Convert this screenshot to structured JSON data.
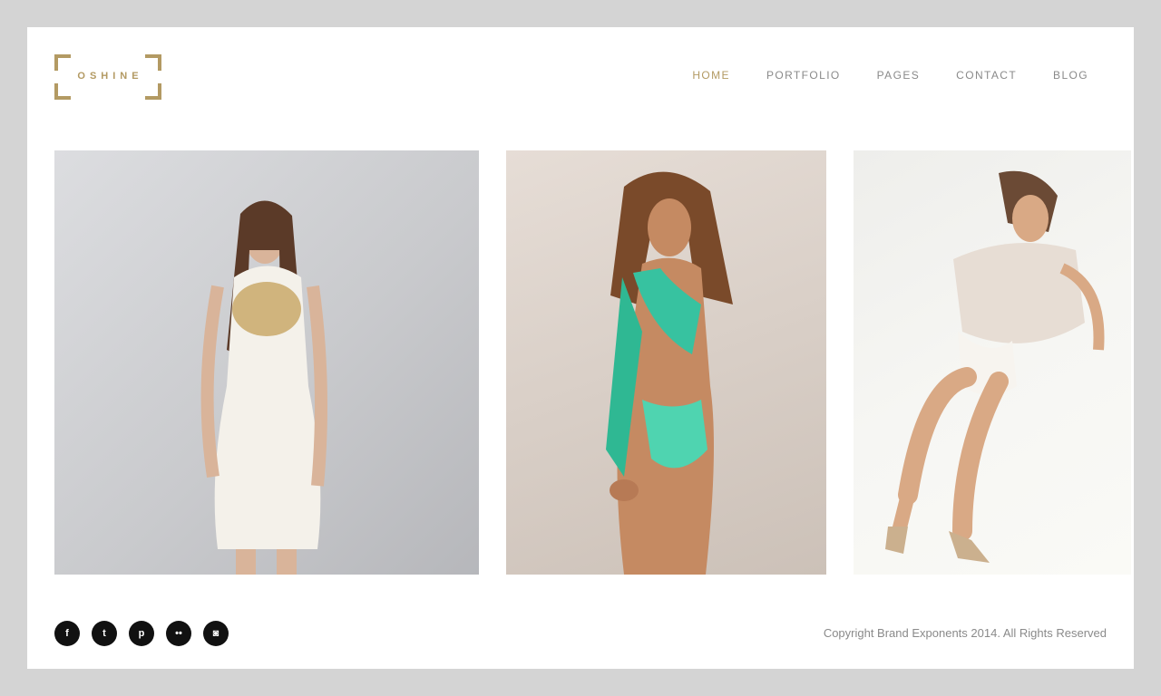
{
  "logo": {
    "text": "OSHINE",
    "color": "#b39a63"
  },
  "nav": {
    "items": [
      {
        "label": "HOME",
        "active": true
      },
      {
        "label": "PORTFOLIO"
      },
      {
        "label": "PAGES"
      },
      {
        "label": "CONTACT"
      },
      {
        "label": "BLOG"
      }
    ]
  },
  "gallery": {
    "images": [
      {
        "name": "model-white-dress-photo"
      },
      {
        "name": "model-green-swimsuit-photo"
      },
      {
        "name": "model-reclining-heels-photo"
      }
    ]
  },
  "social": {
    "icons": [
      {
        "name": "facebook-icon",
        "glyph": "f"
      },
      {
        "name": "twitter-icon",
        "glyph": "t"
      },
      {
        "name": "pinterest-icon",
        "glyph": "p"
      },
      {
        "name": "flickr-icon",
        "glyph": "••"
      },
      {
        "name": "instagram-icon",
        "glyph": "◙"
      }
    ]
  },
  "footer": {
    "copyright": "Copyright Brand Exponents 2014. All Rights Reserved"
  },
  "colors": {
    "accent": "#b39a63",
    "background": "#d4d4d4",
    "nav_text": "#8a8a8a"
  }
}
